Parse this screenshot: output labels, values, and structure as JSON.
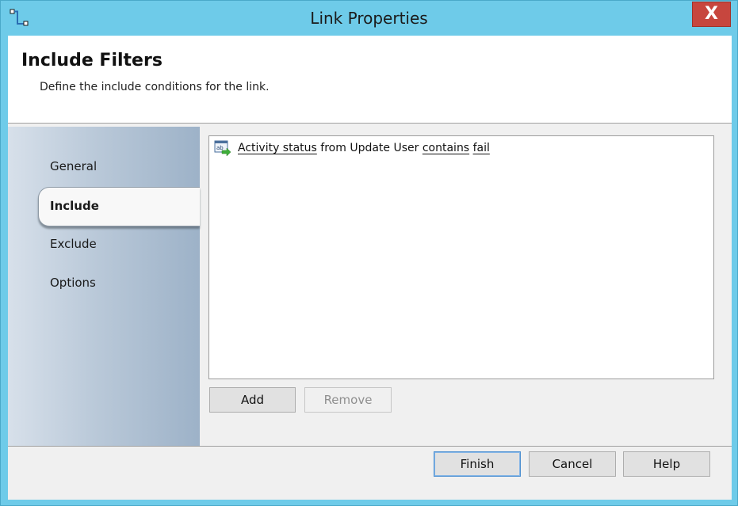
{
  "window": {
    "title": "Link Properties",
    "close_glyph": "X"
  },
  "header": {
    "title": "Include Filters",
    "subtitle": "Define the include conditions for the link."
  },
  "nav": {
    "items": [
      {
        "label": "General"
      },
      {
        "label": "Include"
      },
      {
        "label": "Exclude"
      },
      {
        "label": "Options"
      }
    ],
    "active": "Include"
  },
  "filters": {
    "rows": [
      {
        "icon": "filter-condition-icon",
        "property": "Activity status",
        "from_text": "from",
        "activity": "Update User",
        "operator": "contains",
        "value": "fail"
      }
    ]
  },
  "list_buttons": {
    "add_label": "Add",
    "remove_label": "Remove"
  },
  "footer": {
    "finish_label": "Finish",
    "cancel_label": "Cancel",
    "help_label": "Help"
  },
  "colors": {
    "titlebar": "#6ecbe9",
    "close_button": "#c7463e",
    "default_button_border": "#4c8fd1"
  }
}
